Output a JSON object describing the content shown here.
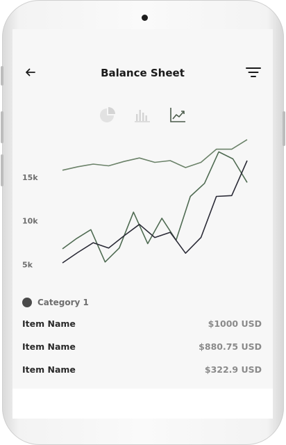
{
  "header": {
    "title": "Balance Sheet"
  },
  "icons": {
    "back": "arrow-left-icon",
    "filter": "filter-icon",
    "pie": "pie-chart-icon",
    "bar": "bar-chart-icon",
    "line": "line-chart-icon"
  },
  "chart_types": {
    "selected": "line",
    "options": [
      "pie",
      "bar",
      "line"
    ]
  },
  "colors": {
    "series_1": "#6b8269",
    "series_2": "#4f6b52",
    "series_3": "#2a2a36",
    "inactive_icon": "#d4d4d4",
    "active_icon": "#4a5a4a"
  },
  "chart_data": {
    "type": "line",
    "y_ticks": [
      "15k",
      "10k",
      "5k"
    ],
    "ylim": [
      2500,
      20000
    ],
    "x_count": 13,
    "grid": false,
    "series": [
      {
        "values": [
          15800,
          16200,
          16500,
          16300,
          16800,
          17200,
          16700,
          16900,
          16100,
          16700,
          18200,
          18200,
          19300
        ]
      },
      {
        "values": [
          6800,
          8000,
          9000,
          5300,
          6900,
          11000,
          7400,
          10300,
          7800,
          12800,
          14300,
          17900,
          17100,
          14400
        ]
      },
      {
        "values": [
          5200,
          6400,
          7500,
          6900,
          8300,
          9600,
          8100,
          8700,
          6300,
          8100,
          12800,
          12900,
          16900
        ]
      }
    ]
  },
  "legend": {
    "label": "Category 1"
  },
  "items": [
    {
      "name": "Item Name",
      "value": "$1000 USD"
    },
    {
      "name": "Item Name",
      "value": "$880.75 USD"
    },
    {
      "name": "Item Name",
      "value": "$322.9 USD"
    }
  ]
}
